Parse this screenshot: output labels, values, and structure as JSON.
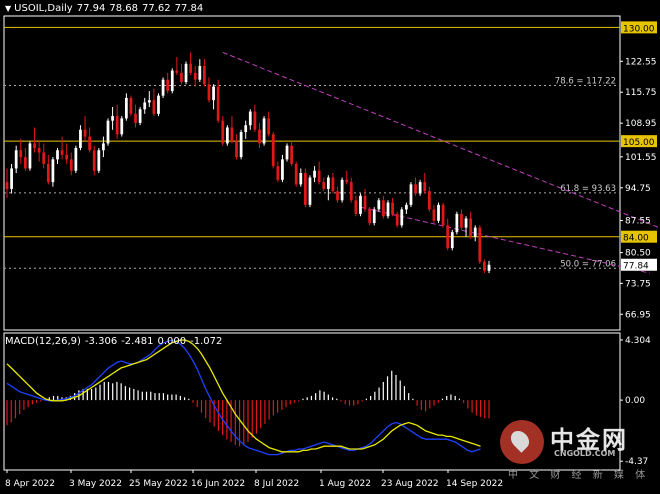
{
  "header": {
    "symbol": "USOIL,Daily",
    "open": "77.94",
    "high": "78.68",
    "low": "77.62",
    "close": "77.84"
  },
  "macd_header": {
    "label": "MACD(12,26,9)",
    "v1": "-3.306",
    "v2": "-2.481",
    "v3": "0.000",
    "v4": "-1.072"
  },
  "watermark": {
    "cn": "中金网",
    "en": "CNGOLD.COM",
    "sub": "中 文 财 经 新 媒 体"
  },
  "chart_data": {
    "type": "candlestick",
    "symbol": "USOIL",
    "timeframe": "Daily",
    "price_axis": {
      "ylim": [
        63.5,
        132.5
      ],
      "ticks": [
        "122.55",
        "115.75",
        "108.95",
        "101.55",
        "94.75",
        "87.55",
        "80.50",
        "73.75",
        "66.95"
      ]
    },
    "x_tick_labels": [
      "8 Apr 2022",
      "3 May 2022",
      "25 May 2022",
      "16 Jun 2022",
      "8 Jul 2022",
      "1 Aug 2022",
      "23 Aug 2022",
      "14 Sep 2022"
    ],
    "horizontal_levels": [
      {
        "price": 130.0,
        "label": "130.00",
        "color": "#e6c400",
        "style": "solid"
      },
      {
        "price": 105.0,
        "label": "105.00",
        "color": "#e6c400",
        "style": "solid"
      },
      {
        "price": 84.0,
        "label": "84.00",
        "color": "#e6c400",
        "style": "solid"
      },
      {
        "price": 77.84,
        "label": "77.84",
        "color": "#ffffff",
        "style": "current"
      }
    ],
    "fibonacci_levels": [
      {
        "price": 117.22,
        "label": "78.6 = 117.22"
      },
      {
        "price": 93.63,
        "label": "61.8 = 93.63"
      },
      {
        "price": 77.06,
        "label": "50.0 = 77.06"
      }
    ],
    "channel": {
      "color": "#c040c0",
      "upper": [
        [
          47,
          124.5
        ],
        [
          147,
          84.0
        ]
      ],
      "lower": [
        [
          77,
          90.5
        ],
        [
          140,
          76.0
        ]
      ]
    },
    "colors": {
      "up": "#ffffff",
      "down": "#e01818",
      "background": "#000000",
      "grid": "#ffffff"
    },
    "candles": [
      [
        96.0,
        99.0,
        92.5,
        94.5
      ],
      [
        94.5,
        100.0,
        93.5,
        99.0
      ],
      [
        99.0,
        104.0,
        98.0,
        103.0
      ],
      [
        103.0,
        105.5,
        100.0,
        101.5
      ],
      [
        101.5,
        103.5,
        98.5,
        99.0
      ],
      [
        99.0,
        105.0,
        98.5,
        104.5
      ],
      [
        104.5,
        108.0,
        102.5,
        103.5
      ],
      [
        103.5,
        105.0,
        100.5,
        102.5
      ],
      [
        102.5,
        104.5,
        99.0,
        100.0
      ],
      [
        100.0,
        102.0,
        95.5,
        96.0
      ],
      [
        96.0,
        101.5,
        95.0,
        101.0
      ],
      [
        101.0,
        103.5,
        100.0,
        103.0
      ],
      [
        103.0,
        106.0,
        101.0,
        102.0
      ],
      [
        102.0,
        104.5,
        100.0,
        101.0
      ],
      [
        101.0,
        102.5,
        97.5,
        98.5
      ],
      [
        98.5,
        104.0,
        98.0,
        103.5
      ],
      [
        103.5,
        108.5,
        103.0,
        107.5
      ],
      [
        107.5,
        110.5,
        105.0,
        106.0
      ],
      [
        106.0,
        108.0,
        102.5,
        103.0
      ],
      [
        103.0,
        104.0,
        97.5,
        98.5
      ],
      [
        98.5,
        103.5,
        98.0,
        103.0
      ],
      [
        103.0,
        106.0,
        101.5,
        104.5
      ],
      [
        104.5,
        110.0,
        104.0,
        109.5
      ],
      [
        109.5,
        112.5,
        107.5,
        110.5
      ],
      [
        110.5,
        113.0,
        105.5,
        106.5
      ],
      [
        106.5,
        110.5,
        106.0,
        110.0
      ],
      [
        110.0,
        115.5,
        109.5,
        114.5
      ],
      [
        114.5,
        115.0,
        110.5,
        111.0
      ],
      [
        111.0,
        113.0,
        108.0,
        109.0
      ],
      [
        109.0,
        112.5,
        108.5,
        112.0
      ],
      [
        112.0,
        114.5,
        111.0,
        113.5
      ],
      [
        113.5,
        116.0,
        112.5,
        114.0
      ],
      [
        114.0,
        116.5,
        110.5,
        111.0
      ],
      [
        111.0,
        115.5,
        110.5,
        115.0
      ],
      [
        115.0,
        119.0,
        114.5,
        118.5
      ],
      [
        118.5,
        120.0,
        115.5,
        116.0
      ],
      [
        116.0,
        121.0,
        115.5,
        120.5
      ],
      [
        120.5,
        123.5,
        119.5,
        120.0
      ],
      [
        120.0,
        122.0,
        117.5,
        118.0
      ],
      [
        118.0,
        122.5,
        117.5,
        122.0
      ],
      [
        122.0,
        124.5,
        119.5,
        120.0
      ],
      [
        120.0,
        121.5,
        117.0,
        118.5
      ],
      [
        118.5,
        123.0,
        118.0,
        121.5
      ],
      [
        121.5,
        123.0,
        117.0,
        117.5
      ],
      [
        117.5,
        119.0,
        113.5,
        114.0
      ],
      [
        114.0,
        117.5,
        112.0,
        117.0
      ],
      [
        117.0,
        118.5,
        109.0,
        109.5
      ],
      [
        109.5,
        110.5,
        104.0,
        104.5
      ],
      [
        104.5,
        108.5,
        104.0,
        108.0
      ],
      [
        108.0,
        110.5,
        104.5,
        105.0
      ],
      [
        105.0,
        106.5,
        101.0,
        101.5
      ],
      [
        101.5,
        107.5,
        101.0,
        107.0
      ],
      [
        107.0,
        109.5,
        105.5,
        108.5
      ],
      [
        108.5,
        112.0,
        107.5,
        111.5
      ],
      [
        111.5,
        113.0,
        107.0,
        107.5
      ],
      [
        107.5,
        109.0,
        103.5,
        104.5
      ],
      [
        104.5,
        110.5,
        104.0,
        110.0
      ],
      [
        110.0,
        111.5,
        106.0,
        106.5
      ],
      [
        106.5,
        107.0,
        99.0,
        99.5
      ],
      [
        99.5,
        100.5,
        96.0,
        96.5
      ],
      [
        96.5,
        102.0,
        96.0,
        101.0
      ],
      [
        101.0,
        104.5,
        100.5,
        104.0
      ],
      [
        104.0,
        105.0,
        99.5,
        100.0
      ],
      [
        100.0,
        100.5,
        95.0,
        95.5
      ],
      [
        95.5,
        99.0,
        95.0,
        98.0
      ],
      [
        98.0,
        99.0,
        90.5,
        91.0
      ],
      [
        91.0,
        97.5,
        90.5,
        97.0
      ],
      [
        97.0,
        99.5,
        96.0,
        98.5
      ],
      [
        98.5,
        100.5,
        95.5,
        96.0
      ],
      [
        96.0,
        97.0,
        94.0,
        94.5
      ],
      [
        94.5,
        97.5,
        92.0,
        97.0
      ],
      [
        97.0,
        98.0,
        93.5,
        94.0
      ],
      [
        94.0,
        95.0,
        91.5,
        92.0
      ],
      [
        92.0,
        97.0,
        91.5,
        96.5
      ],
      [
        96.5,
        98.5,
        95.5,
        96.0
      ],
      [
        96.0,
        97.0,
        91.5,
        92.0
      ],
      [
        92.0,
        93.0,
        88.5,
        89.0
      ],
      [
        89.0,
        93.5,
        88.5,
        93.0
      ],
      [
        93.0,
        94.5,
        89.5,
        90.0
      ],
      [
        90.0,
        90.5,
        86.5,
        87.0
      ],
      [
        87.0,
        90.5,
        86.5,
        90.0
      ],
      [
        90.0,
        92.5,
        89.5,
        92.0
      ],
      [
        92.0,
        93.0,
        88.0,
        88.5
      ],
      [
        88.5,
        92.0,
        88.0,
        91.5
      ],
      [
        91.5,
        92.5,
        88.5,
        89.0
      ],
      [
        89.0,
        89.5,
        86.0,
        86.5
      ],
      [
        86.5,
        90.5,
        86.0,
        90.0
      ],
      [
        90.0,
        91.5,
        89.0,
        91.0
      ],
      [
        91.0,
        96.0,
        90.5,
        95.5
      ],
      [
        95.5,
        97.0,
        93.0,
        93.5
      ],
      [
        93.5,
        96.5,
        93.0,
        96.0
      ],
      [
        96.0,
        98.0,
        93.5,
        94.0
      ],
      [
        94.0,
        95.0,
        89.5,
        90.0
      ],
      [
        90.0,
        91.0,
        87.0,
        87.5
      ],
      [
        87.5,
        91.5,
        87.0,
        91.0
      ],
      [
        91.0,
        91.5,
        86.0,
        86.5
      ],
      [
        86.5,
        88.0,
        81.0,
        81.5
      ],
      [
        81.5,
        85.5,
        81.0,
        85.0
      ],
      [
        85.0,
        89.5,
        84.5,
        89.0
      ],
      [
        89.0,
        90.0,
        85.5,
        86.0
      ],
      [
        86.0,
        88.5,
        84.0,
        88.0
      ],
      [
        88.0,
        89.5,
        83.5,
        84.0
      ],
      [
        84.0,
        86.5,
        83.0,
        86.0
      ],
      [
        86.0,
        86.5,
        78.0,
        78.5
      ],
      [
        78.5,
        79.0,
        76.0,
        76.5
      ],
      [
        76.5,
        78.68,
        76.0,
        77.84
      ]
    ]
  },
  "macd_data": {
    "ylim": [
      -5.0,
      4.8
    ],
    "ticks": [
      "4.304",
      "0.00",
      "-4.37"
    ],
    "histogram_color_up": "#ffffff",
    "histogram_color_down": "#e01818",
    "macd_color": "#2040ff",
    "signal_color": "#e8e800",
    "histogram": [
      -1.8,
      -1.6,
      -1.3,
      -1.0,
      -0.7,
      -0.5,
      -0.3,
      -0.2,
      -0.1,
      0.1,
      0.2,
      0.3,
      0.3,
      0.2,
      0.2,
      0.3,
      0.5,
      0.7,
      0.8,
      0.8,
      0.8,
      0.9,
      1.1,
      1.3,
      1.3,
      1.2,
      1.3,
      1.2,
      1.0,
      0.9,
      0.8,
      0.7,
      0.6,
      0.6,
      0.6,
      0.5,
      0.5,
      0.5,
      0.4,
      0.4,
      0.4,
      0.3,
      0.2,
      0.1,
      -0.2,
      -0.5,
      -0.9,
      -1.3,
      -1.6,
      -1.9,
      -2.2,
      -2.5,
      -2.8,
      -3.0,
      -3.2,
      -3.3,
      -3.2,
      -3.0,
      -2.7,
      -2.4,
      -2.0,
      -1.7,
      -1.4,
      -1.1,
      -0.9,
      -0.7,
      -0.5,
      -0.3,
      -0.2,
      -0.1,
      0.1,
      0.2,
      0.3,
      0.5,
      0.7,
      0.6,
      0.4,
      0.2,
      0.1,
      -0.1,
      -0.3,
      -0.4,
      -0.4,
      -0.3,
      -0.1,
      0.1,
      0.3,
      0.6,
      0.9,
      1.3,
      1.7,
      2.1,
      1.8,
      1.4,
      1.0,
      0.5,
      0.1,
      -0.4,
      -0.7,
      -0.8,
      -0.6,
      -0.4,
      -0.2,
      0.1,
      0.3,
      0.4,
      0.3,
      0.1,
      -0.2,
      -0.6,
      -0.9,
      -1.1,
      -1.2,
      -1.3,
      -1.3
    ],
    "macd": [
      1.2,
      1.0,
      0.8,
      0.6,
      0.5,
      0.4,
      0.3,
      0.2,
      0.1,
      0.0,
      -0.05,
      -0.05,
      0.0,
      0.05,
      0.1,
      0.2,
      0.3,
      0.5,
      0.7,
      0.9,
      1.1,
      1.4,
      1.7,
      2.0,
      2.3,
      2.5,
      2.7,
      2.8,
      2.7,
      2.6,
      2.6,
      2.7,
      2.9,
      3.1,
      3.3,
      3.6,
      3.9,
      4.1,
      4.2,
      4.3,
      4.2,
      4.0,
      3.7,
      3.3,
      2.8,
      2.2,
      1.5,
      0.8,
      0.2,
      -0.4,
      -0.9,
      -1.4,
      -1.8,
      -2.2,
      -2.6,
      -2.9,
      -3.2,
      -3.4,
      -3.5,
      -3.6,
      -3.7,
      -3.8,
      -3.9,
      -3.9,
      -3.9,
      -3.8,
      -3.7,
      -3.6,
      -3.6,
      -3.5,
      -3.5,
      -3.4,
      -3.3,
      -3.2,
      -3.1,
      -3.0,
      -3.1,
      -3.2,
      -3.3,
      -3.4,
      -3.5,
      -3.6,
      -3.6,
      -3.5,
      -3.4,
      -3.3,
      -3.1,
      -2.8,
      -2.5,
      -2.2,
      -1.9,
      -1.7,
      -1.6,
      -1.7,
      -1.9,
      -2.1,
      -2.3,
      -2.5,
      -2.7,
      -2.8,
      -2.8,
      -2.8,
      -2.8,
      -2.8,
      -2.8,
      -2.9,
      -3.0,
      -3.2,
      -3.4,
      -3.6,
      -3.7,
      -3.6,
      -3.5
    ],
    "signal": [
      2.6,
      2.3,
      2.0,
      1.7,
      1.4,
      1.1,
      0.8,
      0.5,
      0.3,
      0.1,
      0.0,
      -0.05,
      -0.05,
      -0.05,
      0.0,
      0.1,
      0.2,
      0.3,
      0.5,
      0.7,
      0.9,
      1.1,
      1.3,
      1.5,
      1.7,
      1.9,
      2.1,
      2.3,
      2.4,
      2.5,
      2.6,
      2.7,
      2.8,
      2.9,
      3.1,
      3.3,
      3.5,
      3.7,
      3.9,
      4.1,
      4.2,
      4.3,
      4.3,
      4.2,
      4.0,
      3.7,
      3.3,
      2.8,
      2.3,
      1.7,
      1.1,
      0.5,
      0.0,
      -0.5,
      -1.0,
      -1.4,
      -1.8,
      -2.2,
      -2.5,
      -2.8,
      -3.0,
      -3.2,
      -3.4,
      -3.5,
      -3.6,
      -3.7,
      -3.7,
      -3.7,
      -3.7,
      -3.7,
      -3.6,
      -3.6,
      -3.5,
      -3.5,
      -3.4,
      -3.3,
      -3.3,
      -3.3,
      -3.3,
      -3.3,
      -3.4,
      -3.5,
      -3.5,
      -3.5,
      -3.5,
      -3.4,
      -3.3,
      -3.2,
      -3.0,
      -2.8,
      -2.5,
      -2.2,
      -2.0,
      -1.8,
      -1.7,
      -1.6,
      -1.7,
      -1.8,
      -2.0,
      -2.2,
      -2.3,
      -2.4,
      -2.5,
      -2.5,
      -2.6,
      -2.6,
      -2.7,
      -2.8,
      -2.9,
      -3.0,
      -3.1,
      -3.2,
      -3.3
    ]
  }
}
